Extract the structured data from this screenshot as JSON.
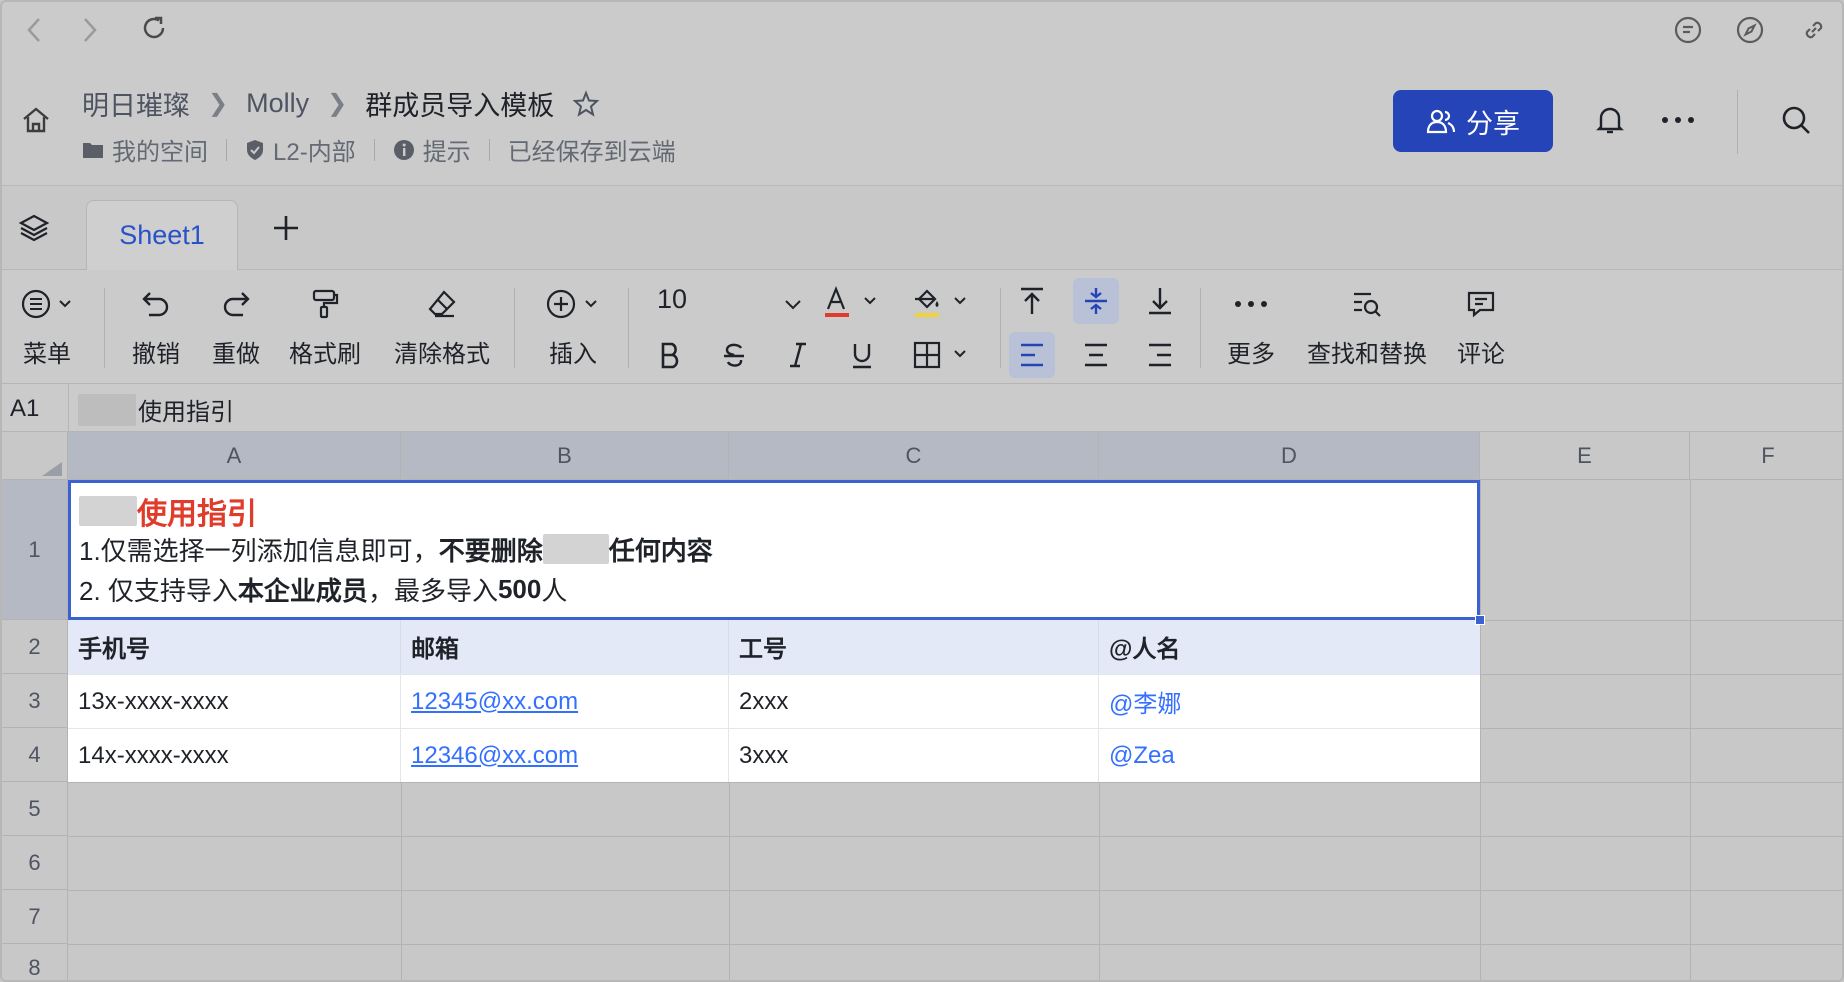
{
  "browser": {
    "icons": [
      "back-icon",
      "forward-icon",
      "reload-icon",
      "comment-icon",
      "compass-icon",
      "link-icon"
    ]
  },
  "header": {
    "breadcrumb": [
      "明日璀璨",
      "Molly",
      "群成员导入模板"
    ],
    "meta": {
      "space": "我的空间",
      "security": "L2-内部",
      "hint": "提示",
      "save_status": "已经保存到云端"
    },
    "share_label": "分享"
  },
  "tabs": {
    "sheets": [
      "Sheet1"
    ],
    "active": "Sheet1"
  },
  "toolbar": {
    "menu": "菜单",
    "undo": "撤销",
    "redo": "重做",
    "format_painter": "格式刷",
    "clear_format": "清除格式",
    "insert": "插入",
    "font_size": "10",
    "more": "更多",
    "find_replace": "查找和替换",
    "comment": "评论",
    "colors": {
      "text": "#e03c2b",
      "fill": "#f2d23a",
      "accent": "#2444b8"
    }
  },
  "formula": {
    "cell_ref": "A1",
    "value": "使用指引"
  },
  "grid": {
    "columns": [
      "A",
      "B",
      "C",
      "D",
      "E",
      "F"
    ],
    "rows": [
      "1",
      "2",
      "3",
      "4",
      "5",
      "6",
      "7",
      "8"
    ],
    "guide": {
      "title": "使用指引",
      "line1_a": "1.仅需选择一列添加信息即可，",
      "line1_b": "不要删除",
      "line1_c": "任何内容",
      "line2_a": "2. 仅支持导入",
      "line2_b": "本企业成员",
      "line2_c": "，最多导入",
      "line2_d": "500",
      "line2_e": "人"
    },
    "header_row": [
      "手机号",
      "邮箱",
      "工号",
      "@人名"
    ],
    "data": [
      [
        "13x-xxxx-xxxx",
        "12345@xx.com",
        "2xxx",
        "@李娜"
      ],
      [
        "14x-xxxx-xxxx",
        "12346@xx.com",
        "3xxx",
        "@Zea"
      ]
    ]
  }
}
